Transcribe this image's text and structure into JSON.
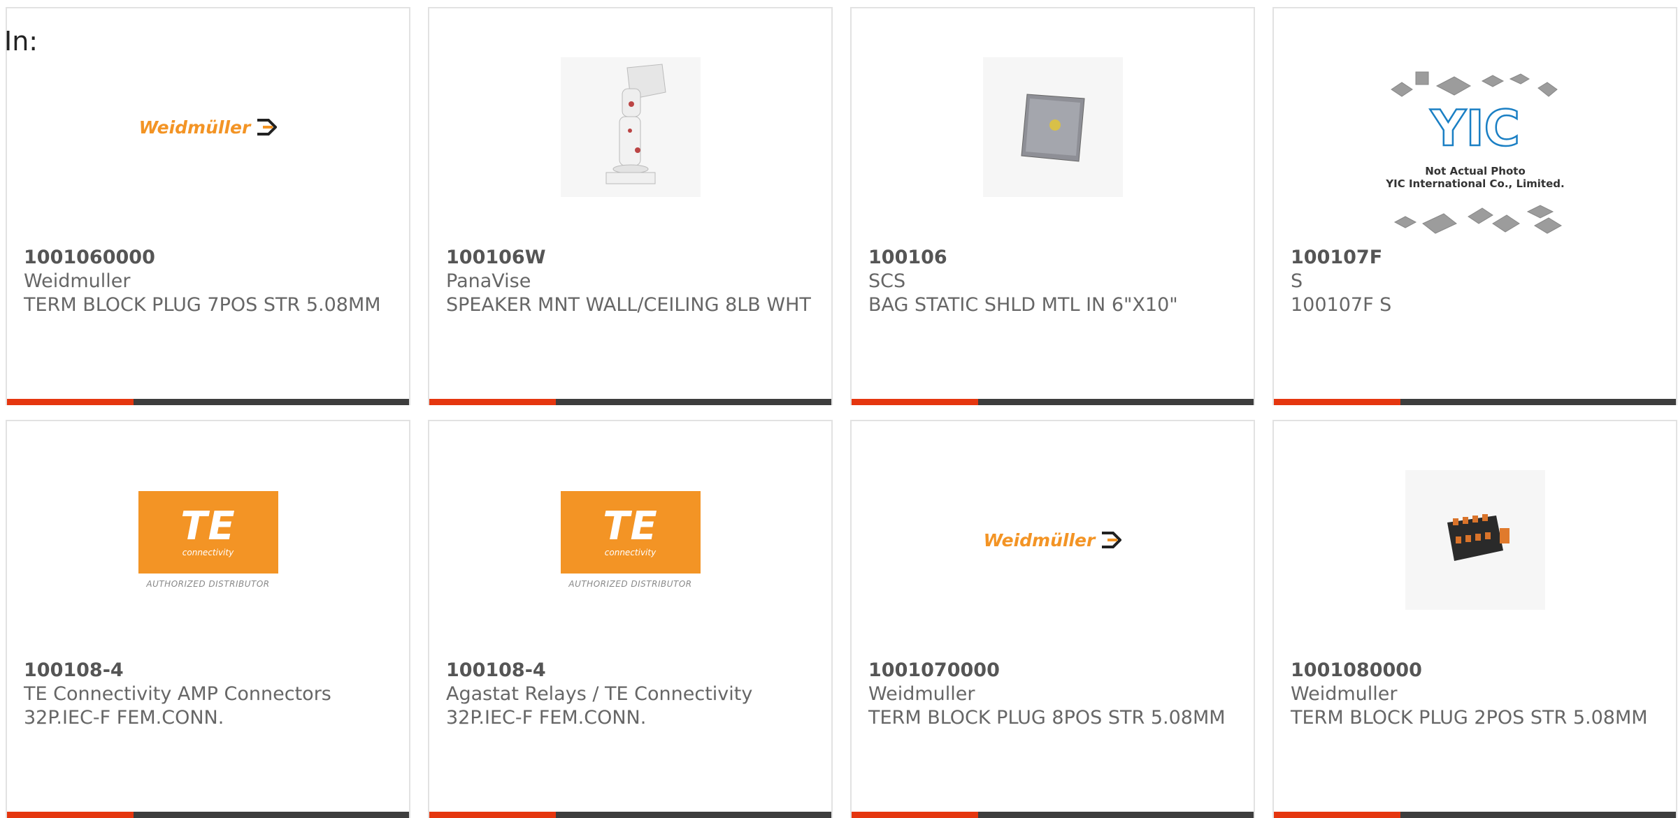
{
  "header": {
    "in_label": "In:"
  },
  "products": [
    {
      "part_number": "1001060000",
      "manufacturer": "Weidmuller",
      "description": "TERM BLOCK PLUG 7POS STR 5.08MM",
      "image": "weidmuller-logo",
      "logo_text": "Weidmüller"
    },
    {
      "part_number": "100106W",
      "manufacturer": "PanaVise",
      "description": "SPEAKER MNT WALL/CEILING 8LB WHT",
      "image": "speaker-mount-photo"
    },
    {
      "part_number": "100106",
      "manufacturer": "SCS",
      "description": "BAG STATIC SHLD MTL IN 6\"X10\"",
      "image": "static-bag-photo"
    },
    {
      "part_number": "100107F",
      "manufacturer": "S",
      "description": "100107F S",
      "image": "yic-placeholder",
      "logo_text": "YIC",
      "photo_note_1": "Not Actual Photo",
      "photo_note_2": "YIC International Co., Limited."
    },
    {
      "part_number": "100108-4",
      "manufacturer": "TE Connectivity AMP Connectors",
      "description": "32P.IEC-F FEM.CONN.",
      "image": "te-logo",
      "logo_text": "TE",
      "logo_sub": "connectivity",
      "logo_caption": "AUTHORIZED DISTRIBUTOR"
    },
    {
      "part_number": "100108-4",
      "manufacturer": "Agastat Relays / TE Connectivity",
      "description": "32P.IEC-F FEM.CONN.",
      "image": "te-logo",
      "logo_text": "TE",
      "logo_sub": "connectivity",
      "logo_caption": "AUTHORIZED DISTRIBUTOR"
    },
    {
      "part_number": "1001070000",
      "manufacturer": "Weidmuller",
      "description": "TERM BLOCK PLUG 8POS STR 5.08MM",
      "image": "weidmuller-logo",
      "logo_text": "Weidmüller"
    },
    {
      "part_number": "1001080000",
      "manufacturer": "Weidmuller",
      "description": "TERM BLOCK PLUG 2POS STR 5.08MM",
      "image": "terminal-block-photo"
    }
  ],
  "colors": {
    "accent_bar": "#e5360f",
    "dark_bar": "#3d3d3d",
    "brand_orange": "#f39425",
    "yic_blue": "#1a7fc4"
  }
}
